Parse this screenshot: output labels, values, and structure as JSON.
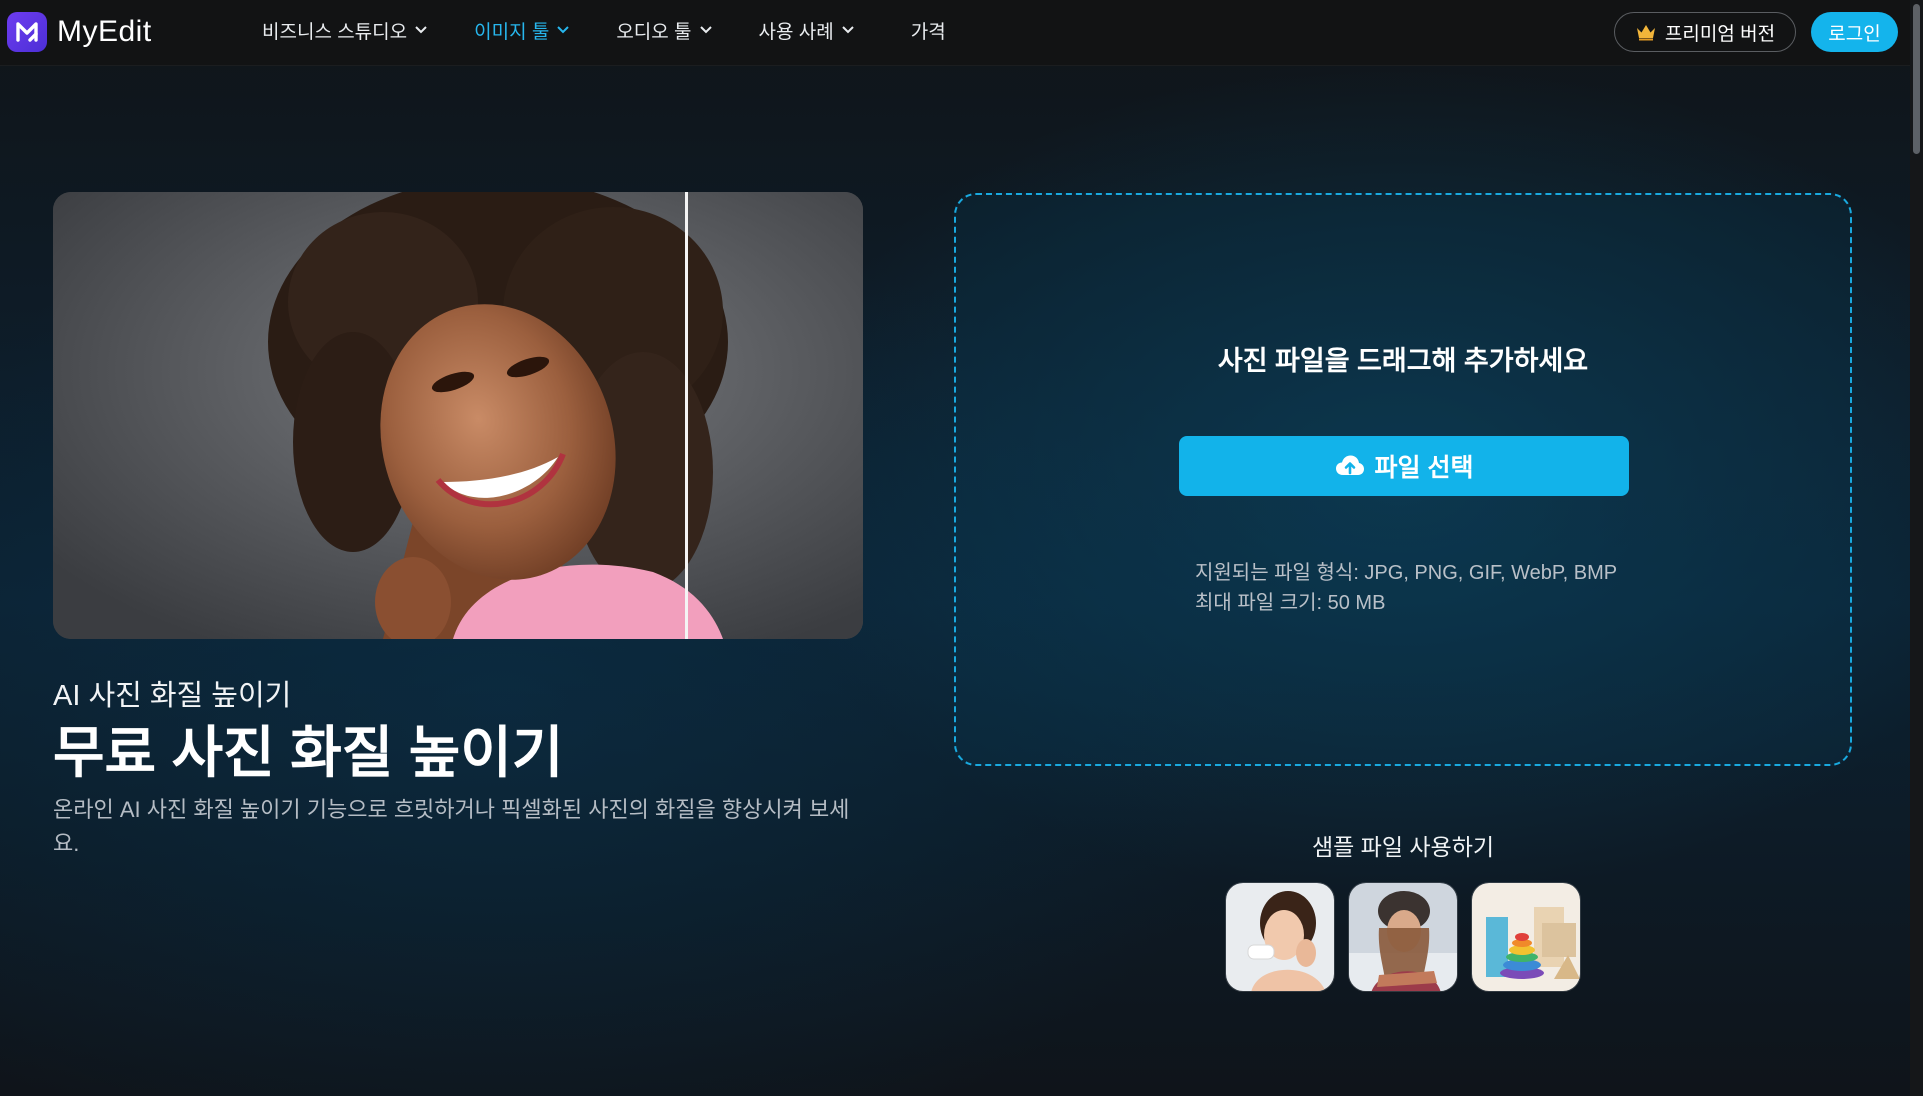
{
  "brand": {
    "name": "MyEdit",
    "accent": "#14b4ec",
    "logo_color": "#5b34e6"
  },
  "nav": {
    "items": [
      {
        "label": "비즈니스 스튜디오",
        "has_dropdown": true,
        "active": false
      },
      {
        "label": "이미지 툴",
        "has_dropdown": true,
        "active": true
      },
      {
        "label": "오디오 툴",
        "has_dropdown": true,
        "active": false
      },
      {
        "label": "사용 사례",
        "has_dropdown": true,
        "active": false
      },
      {
        "label": "가격",
        "has_dropdown": false,
        "active": false
      }
    ],
    "premium_label": "프리미엄 버전",
    "premium_icon": "crown-icon",
    "login_label": "로그인"
  },
  "hero": {
    "image_alt": "woman-portrait-before-after",
    "subtitle": "AI 사진 화질 높이기",
    "title": "무료 사진 화질 높이기",
    "description": "온라인 AI 사진 화질 높이기 기능으로 흐릿하거나 픽셀화된 사진의 화질을 향상시켜 보세요."
  },
  "upload": {
    "drop_text": "사진 파일을 드래그해 추가하세요",
    "button_label": "파일 선택",
    "button_icon": "cloud-upload-icon",
    "formats_label": "지원되는 파일 형식: JPG, PNG, GIF, WebP, BMP",
    "max_size_label": "최대 파일 크기: 50 MB"
  },
  "samples": {
    "title": "샘플 파일 사용하기",
    "items": [
      "sample-woman-skincare",
      "sample-woman-winter",
      "sample-toy-blocks"
    ]
  }
}
